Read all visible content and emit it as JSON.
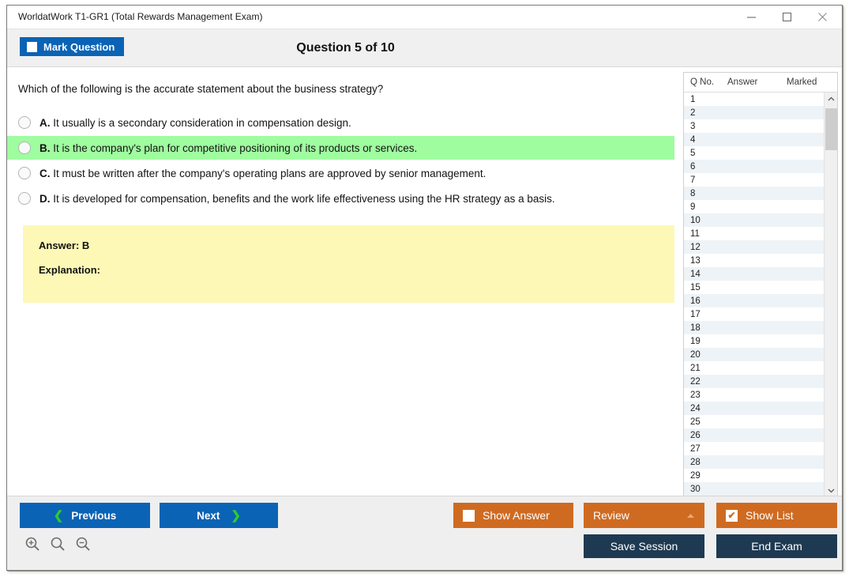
{
  "window": {
    "title": "WorldatWork T1-GR1 (Total Rewards Management Exam)",
    "minimize_label": "Minimize",
    "maximize_label": "Maximize",
    "close_label": "Close"
  },
  "header": {
    "mark_question_label": "Mark Question",
    "mark_question_checked": false,
    "question_counter": "Question 5 of 10"
  },
  "question": {
    "stem": "Which of the following is the accurate statement about the business strategy?",
    "options": [
      {
        "letter": "A.",
        "text": "It usually is a secondary consideration in compensation design.",
        "correct": false
      },
      {
        "letter": "B.",
        "text": "It is the company's plan for competitive positioning of its products or services.",
        "correct": true
      },
      {
        "letter": "C.",
        "text": "It must be written after the company's operating plans are approved by senior management.",
        "correct": false
      },
      {
        "letter": "D.",
        "text": "It is developed for compensation, benefits and the work life effectiveness using the HR strategy as a basis.",
        "correct": false
      }
    ]
  },
  "answer_box": {
    "answer_line": "Answer: B",
    "explanation_line": "Explanation:",
    "background_color": "#fdf8b6"
  },
  "list_panel": {
    "columns": [
      "Q No.",
      "Answer",
      "Marked"
    ],
    "rows": [
      {
        "q_no": "1",
        "answer": "",
        "marked": ""
      },
      {
        "q_no": "2",
        "answer": "",
        "marked": ""
      },
      {
        "q_no": "3",
        "answer": "",
        "marked": ""
      },
      {
        "q_no": "4",
        "answer": "",
        "marked": ""
      },
      {
        "q_no": "5",
        "answer": "",
        "marked": ""
      },
      {
        "q_no": "6",
        "answer": "",
        "marked": ""
      },
      {
        "q_no": "7",
        "answer": "",
        "marked": ""
      },
      {
        "q_no": "8",
        "answer": "",
        "marked": ""
      },
      {
        "q_no": "9",
        "answer": "",
        "marked": ""
      },
      {
        "q_no": "10",
        "answer": "",
        "marked": ""
      },
      {
        "q_no": "11",
        "answer": "",
        "marked": ""
      },
      {
        "q_no": "12",
        "answer": "",
        "marked": ""
      },
      {
        "q_no": "13",
        "answer": "",
        "marked": ""
      },
      {
        "q_no": "14",
        "answer": "",
        "marked": ""
      },
      {
        "q_no": "15",
        "answer": "",
        "marked": ""
      },
      {
        "q_no": "16",
        "answer": "",
        "marked": ""
      },
      {
        "q_no": "17",
        "answer": "",
        "marked": ""
      },
      {
        "q_no": "18",
        "answer": "",
        "marked": ""
      },
      {
        "q_no": "19",
        "answer": "",
        "marked": ""
      },
      {
        "q_no": "20",
        "answer": "",
        "marked": ""
      },
      {
        "q_no": "21",
        "answer": "",
        "marked": ""
      },
      {
        "q_no": "22",
        "answer": "",
        "marked": ""
      },
      {
        "q_no": "23",
        "answer": "",
        "marked": ""
      },
      {
        "q_no": "24",
        "answer": "",
        "marked": ""
      },
      {
        "q_no": "25",
        "answer": "",
        "marked": ""
      },
      {
        "q_no": "26",
        "answer": "",
        "marked": ""
      },
      {
        "q_no": "27",
        "answer": "",
        "marked": ""
      },
      {
        "q_no": "28",
        "answer": "",
        "marked": ""
      },
      {
        "q_no": "29",
        "answer": "",
        "marked": ""
      },
      {
        "q_no": "30",
        "answer": "",
        "marked": ""
      }
    ]
  },
  "toolbar": {
    "previous_label": "Previous",
    "next_label": "Next",
    "show_answer_label": "Show Answer",
    "show_answer_checked": false,
    "review_label": "Review",
    "show_list_label": "Show List",
    "show_list_checked": true,
    "show_list_check_glyph": "✔",
    "save_session_label": "Save Session",
    "end_exam_label": "End Exam",
    "zoom_in_label": "Zoom In",
    "zoom_reset_label": "Zoom Reset",
    "zoom_out_label": "Zoom Out"
  },
  "colors": {
    "blue": "#0b63b5",
    "orange": "#cf6b21",
    "navy": "#1e3a52",
    "correct_green": "#9ffc9f",
    "answer_yellow": "#fdf8b6",
    "chevron_green": "#2ecb2e"
  }
}
